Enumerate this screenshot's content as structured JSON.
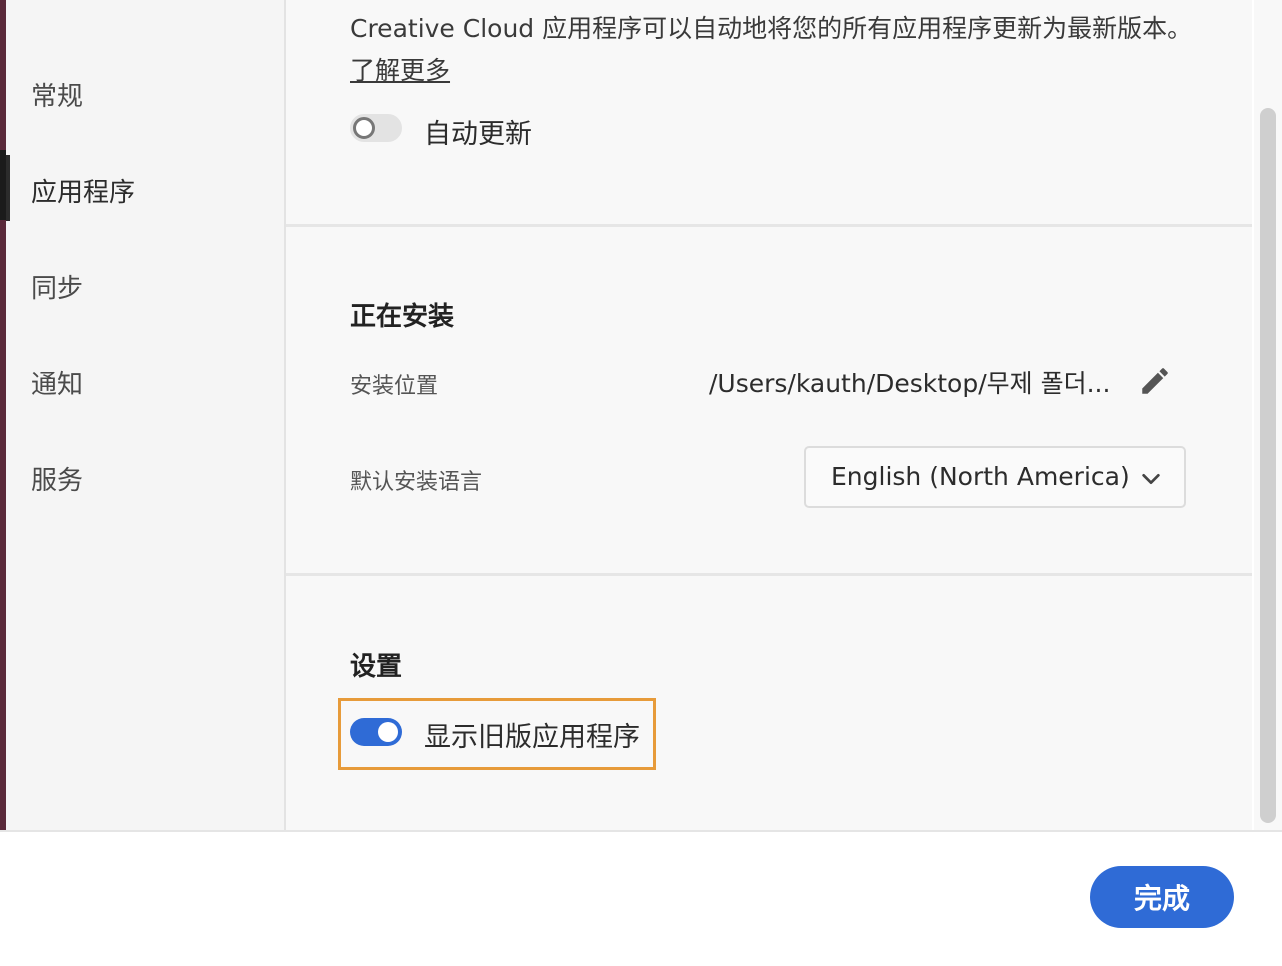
{
  "sidebar": {
    "items": [
      {
        "label": "常规"
      },
      {
        "label": "应用程序"
      },
      {
        "label": "同步"
      },
      {
        "label": "通知"
      },
      {
        "label": "服务"
      }
    ],
    "active_index": 1
  },
  "auto_update": {
    "description": "Creative Cloud 应用程序可以自动地将您的所有应用程序更新为最新版本。",
    "learn_more": "了解更多",
    "toggle_label": "自动更新",
    "toggle_on": false
  },
  "installing": {
    "title": "正在安装",
    "location_label": "安装位置",
    "location_value": "/Users/kauth/Desktop/무제 폴더...",
    "language_label": "默认安装语言",
    "language_value": "English (North America)"
  },
  "settings": {
    "title": "设置",
    "toggle_label": "显示旧版应用程序",
    "toggle_on": true
  },
  "footer": {
    "done_label": "完成"
  },
  "colors": {
    "accent": "#2f6bd6",
    "highlight": "#e79b3a"
  }
}
